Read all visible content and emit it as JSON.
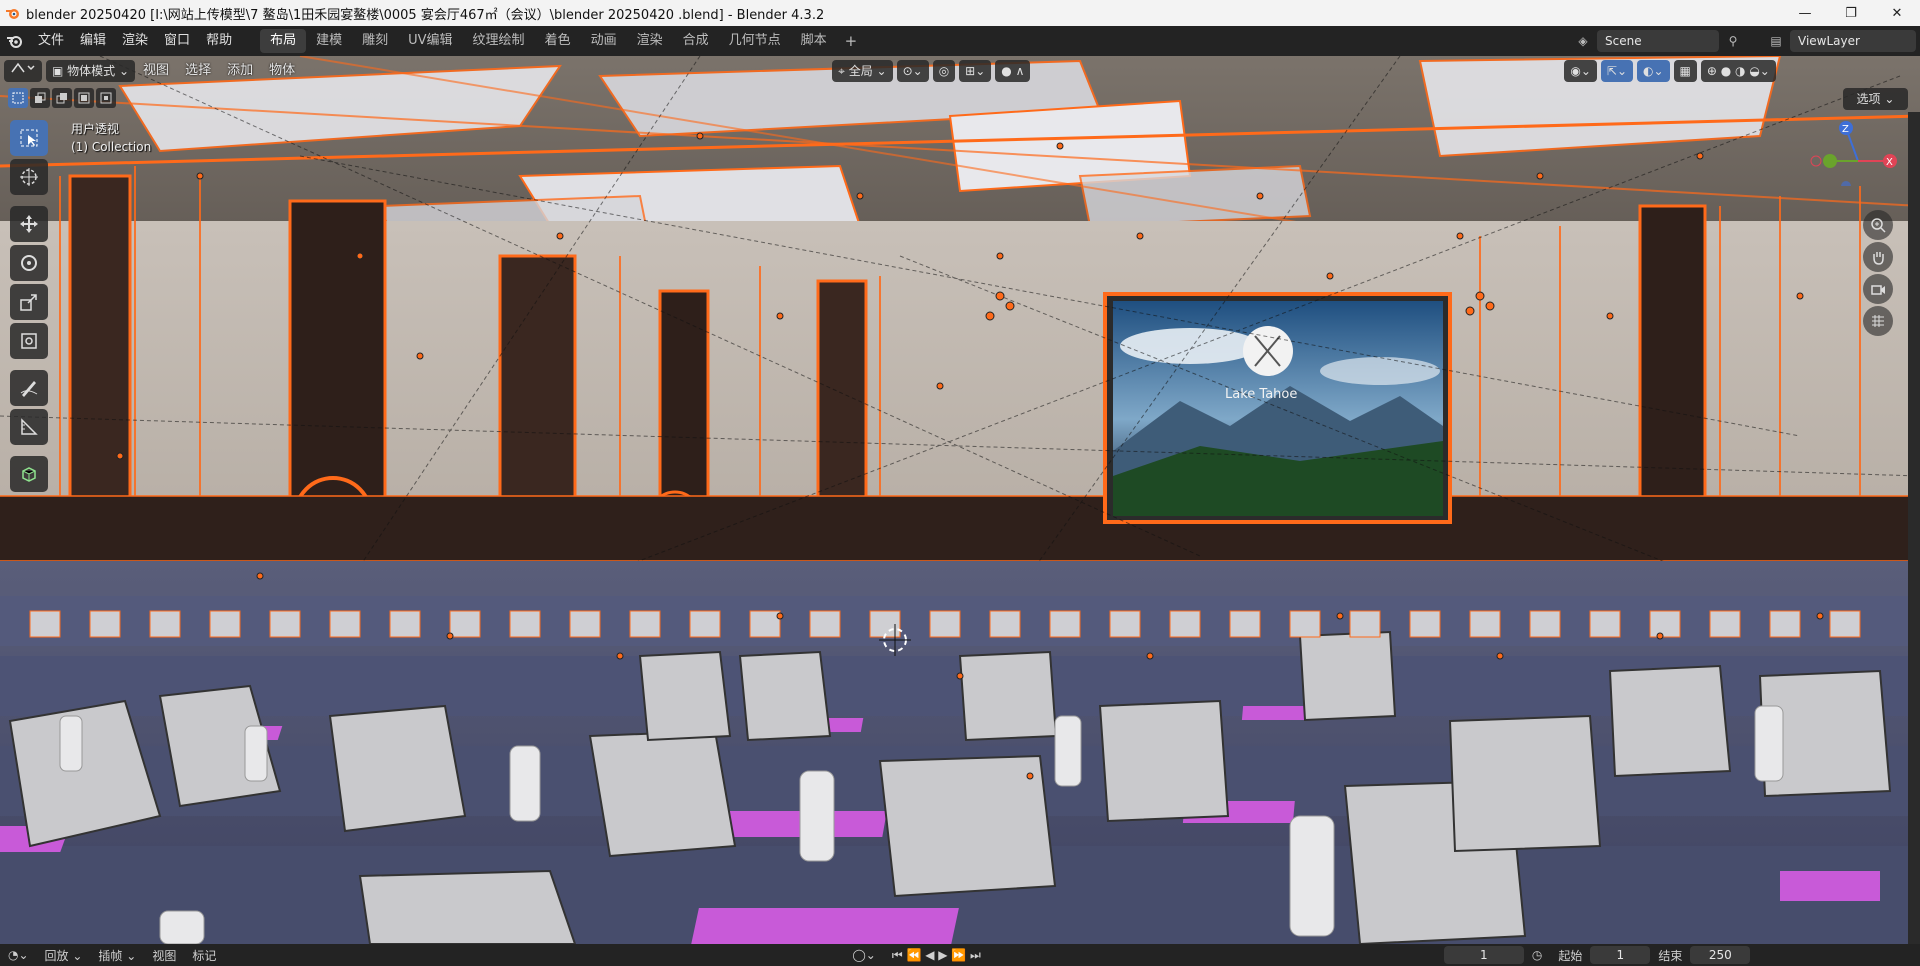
{
  "window": {
    "title": "blender 20250420  [I:\\网站上传模型\\7 鳌岛\\1田禾园宴鳌楼\\0005 宴会厅467㎡（会议）\\blender 20250420 .blend] - Blender 4.3.2",
    "minimize": "—",
    "restore": "❐",
    "close": "✕"
  },
  "menubar": {
    "items": [
      "文件",
      "编辑",
      "渲染",
      "窗口",
      "帮助"
    ],
    "workspaces": [
      "布局",
      "建模",
      "雕刻",
      "UV编辑",
      "纹理绘制",
      "着色",
      "动画",
      "渲染",
      "合成",
      "几何节点",
      "脚本"
    ],
    "active_workspace": "布局",
    "add_workspace": "+",
    "scene_label": "Scene",
    "view_layer_label": "ViewLayer"
  },
  "viewport_header": {
    "mode": "物体模式",
    "menus": [
      "视图",
      "选择",
      "添加",
      "物体"
    ],
    "transform_orientation": "全局",
    "options": "选项"
  },
  "viewport_overlay": {
    "view_name": "用户透视",
    "collection": "(1) Collection"
  },
  "screen_text": "Lake Tahoe",
  "tools": [
    "select-box",
    "cursor",
    "move",
    "rotate",
    "scale",
    "transform",
    "annotate",
    "measure",
    "add-cube"
  ],
  "timeline": {
    "playback": "回放",
    "keying": "插帧",
    "view": "视图",
    "marker": "标记",
    "current_frame": "1",
    "start_label": "起始",
    "start_value": "1",
    "end_label": "结束",
    "end_value": "250"
  },
  "colors": {
    "selection_orange": "#ff6a1a",
    "active_blue": "#4772b3",
    "tablecloth": "#4b5173",
    "pad_magenta": "#c85ad8",
    "chair": "#c9c9cc"
  }
}
